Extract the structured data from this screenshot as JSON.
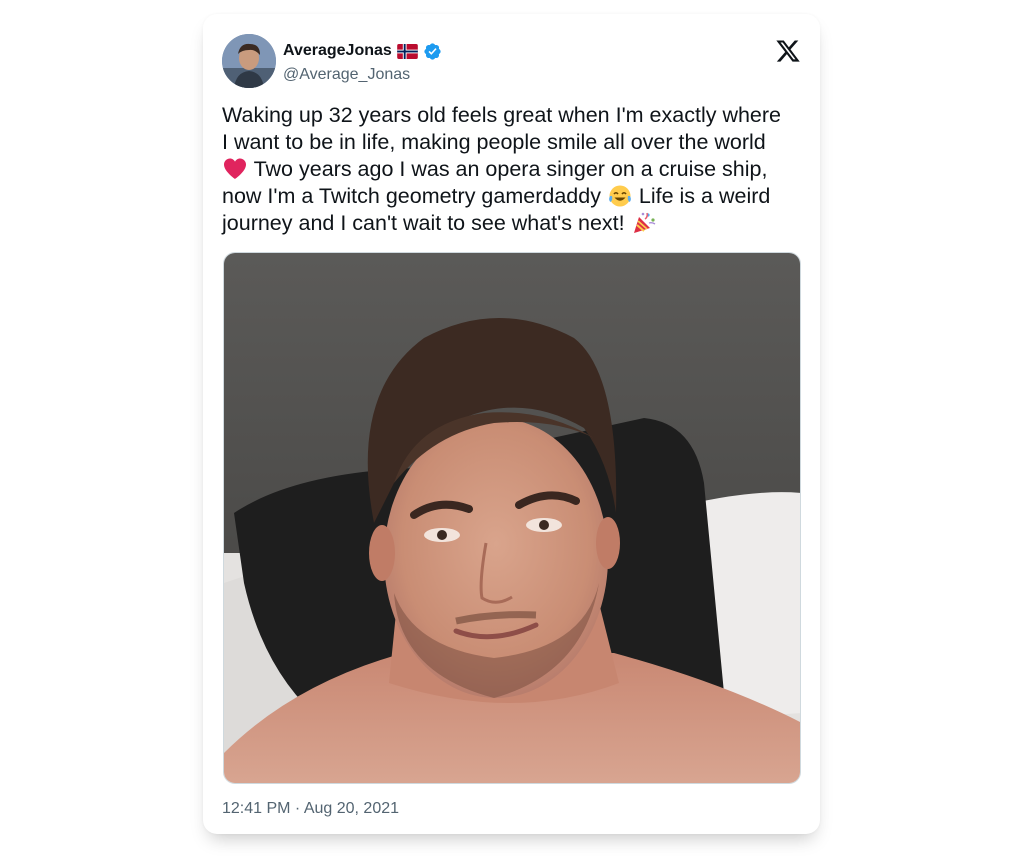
{
  "tweet": {
    "author": {
      "display_name": "AverageJonas",
      "handle": "@Average_Jonas",
      "flag_icon": "norway-flag-icon",
      "verified_icon": "verified-badge-icon",
      "verified_color": "#1d9bf0"
    },
    "brand_icon": "x-logo-icon",
    "text_lines": [
      "Waking up 32 years old feels great when I'm exactly where",
      "I want to be in life, making people smile all over the world",
      " Two years ago I was an opera singer on a cruise ship,",
      "now I'm a Twitch geometry gamerdaddy",
      " Life is a weird",
      "journey and I can't wait to see what's next!"
    ],
    "emojis": [
      "red-heart-emoji",
      "tears-of-joy-emoji",
      "party-popper-emoji"
    ],
    "media": {
      "type": "photo",
      "subject": "selfie-photo"
    },
    "timestamp": "12:41 PM · Aug 20, 2021"
  },
  "colors": {
    "text_primary": "#0f1419",
    "text_secondary": "#536471",
    "heart": "#e0245e"
  }
}
